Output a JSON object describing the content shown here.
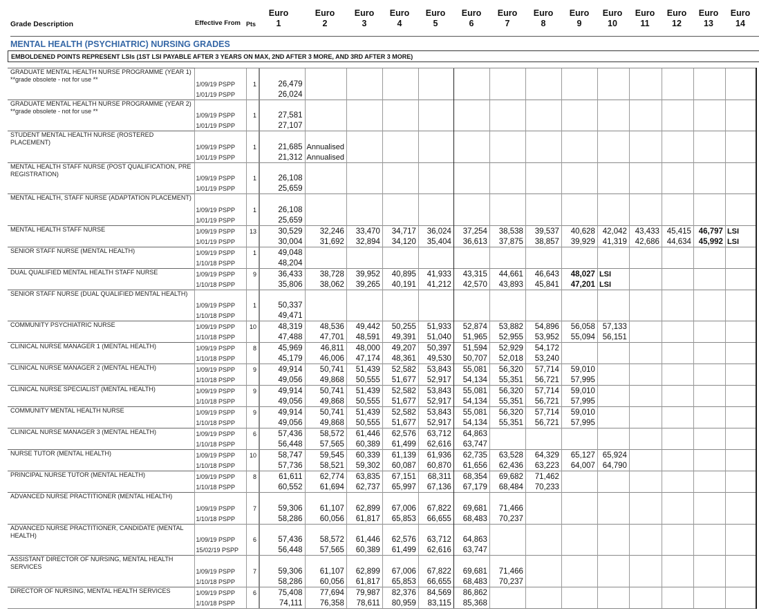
{
  "header": {
    "grade_description": "Grade Description",
    "effective_from": "Effective From",
    "pts": "Pts",
    "euro_label": "Euro",
    "euro_columns": [
      "1",
      "2",
      "3",
      "4",
      "5",
      "6",
      "7",
      "8",
      "9",
      "10",
      "11",
      "12",
      "13",
      "14"
    ]
  },
  "section_title": "MENTAL HEALTH (PSYCHIATRIC) NURSING GRADES",
  "note": "EMBOLDENED POINTS REPRESENT LSIs (1ST LSI PAYABLE AFTER 3 YEARS ON MAX, 2ND AFTER 3 MORE, AND 3RD AFTER 3 MORE)",
  "grades": [
    {
      "desc": "GRADUATE MENTAL HEALTH NURSE PROGRAMME (YEAR 1) **grade obsolete - not for use **",
      "tall": true,
      "pts": "1",
      "rows": [
        {
          "date": "1/09/19 PSPP",
          "values": [
            "26,479"
          ]
        },
        {
          "date": "1/01/19 PSPP",
          "values": [
            "26,024"
          ]
        }
      ]
    },
    {
      "desc": "GRADUATE MENTAL HEALTH NURSE PROGRAMME (YEAR 2) **grade obsolete - not for use **",
      "tall": true,
      "pts": "1",
      "rows": [
        {
          "date": "1/09/19 PSPP",
          "values": [
            "27,581"
          ]
        },
        {
          "date": "1/01/19 PSPP",
          "values": [
            "27,107"
          ]
        }
      ]
    },
    {
      "desc": "STUDENT MENTAL HEALTH NURSE (ROSTERED PLACEMENT)",
      "tall": true,
      "pts": "1",
      "rows": [
        {
          "date": "1/09/19 PSPP",
          "values": [
            "21,685",
            "Annualised"
          ]
        },
        {
          "date": "1/01/19 PSPP",
          "values": [
            "21,312",
            "Annualised"
          ]
        }
      ]
    },
    {
      "desc": "MENTAL HEALTH STAFF NURSE (POST QUALIFICATION, PRE REGISTRATION)",
      "tall": true,
      "pts": "1",
      "rows": [
        {
          "date": "1/09/19 PSPP",
          "values": [
            "26,108"
          ]
        },
        {
          "date": "1/01/19 PSPP",
          "values": [
            "25,659"
          ]
        }
      ]
    },
    {
      "desc": "MENTAL HEALTH, STAFF NURSE (ADAPTATION PLACEMENT)",
      "tall": true,
      "pts": "1",
      "rows": [
        {
          "date": "1/09/19 PSPP",
          "values": [
            "26,108"
          ]
        },
        {
          "date": "1/01/19 PSPP",
          "values": [
            "25,659"
          ]
        }
      ]
    },
    {
      "desc": "MENTAL HEALTH STAFF NURSE",
      "tall": false,
      "pts": "13",
      "lsi_index": 12,
      "rows": [
        {
          "date": "1/09/19 PSPP",
          "values": [
            "30,529",
            "32,246",
            "33,470",
            "34,717",
            "36,024",
            "37,254",
            "38,538",
            "39,537",
            "40,628",
            "42,042",
            "43,433",
            "45,415",
            "46,797",
            "LSI"
          ]
        },
        {
          "date": "1/01/19 PSPP",
          "values": [
            "30,004",
            "31,692",
            "32,894",
            "34,120",
            "35,404",
            "36,613",
            "37,875",
            "38,857",
            "39,929",
            "41,319",
            "42,686",
            "44,634",
            "45,992",
            "LSI"
          ]
        }
      ]
    },
    {
      "desc": "SENIOR STAFF NURSE (MENTAL HEALTH)",
      "tall": false,
      "pts": "1",
      "rows": [
        {
          "date": "1/09/19 PSPP",
          "values": [
            "49,048"
          ]
        },
        {
          "date": "1/10/18 PSPP",
          "values": [
            "48,204"
          ]
        }
      ]
    },
    {
      "desc": "DUAL QUALIFIED MENTAL HEALTH STAFF NURSE",
      "tall": false,
      "pts": "9",
      "lsi_index": 8,
      "rows": [
        {
          "date": "1/09/19 PSPP",
          "values": [
            "36,433",
            "38,728",
            "39,952",
            "40,895",
            "41,933",
            "43,315",
            "44,661",
            "46,643",
            "48,027",
            "LSI"
          ]
        },
        {
          "date": "1/10/18 PSPP",
          "values": [
            "35,806",
            "38,062",
            "39,265",
            "40,191",
            "41,212",
            "42,570",
            "43,893",
            "45,841",
            "47,201",
            "LSI"
          ]
        }
      ]
    },
    {
      "desc": "SENIOR STAFF NURSE (DUAL QUALIFIED MENTAL HEALTH)",
      "tall": true,
      "pts": "1",
      "rows": [
        {
          "date": "1/09/19 PSPP",
          "values": [
            "50,337"
          ]
        },
        {
          "date": "1/10/18 PSPP",
          "values": [
            "49,471"
          ]
        }
      ]
    },
    {
      "desc": "COMMUNITY PSYCHIATRIC NURSE",
      "tall": false,
      "pts": "10",
      "rows": [
        {
          "date": "1/09/19 PSPP",
          "values": [
            "48,319",
            "48,536",
            "49,442",
            "50,255",
            "51,933",
            "52,874",
            "53,882",
            "54,896",
            "56,058",
            "57,133"
          ]
        },
        {
          "date": "1/10/18 PSPP",
          "values": [
            "47,488",
            "47,701",
            "48,591",
            "49,391",
            "51,040",
            "51,965",
            "52,955",
            "53,952",
            "55,094",
            "56,151"
          ]
        }
      ]
    },
    {
      "desc": "CLINICAL NURSE MANAGER 1 (MENTAL HEALTH)",
      "tall": false,
      "pts": "8",
      "rows": [
        {
          "date": "1/09/19 PSPP",
          "values": [
            "45,969",
            "46,811",
            "48,000",
            "49,207",
            "50,397",
            "51,594",
            "52,929",
            "54,172"
          ]
        },
        {
          "date": "1/10/18 PSPP",
          "values": [
            "45,179",
            "46,006",
            "47,174",
            "48,361",
            "49,530",
            "50,707",
            "52,018",
            "53,240"
          ]
        }
      ]
    },
    {
      "desc": "CLINICAL NURSE MANAGER 2  (MENTAL HEALTH)",
      "tall": false,
      "pts": "9",
      "rows": [
        {
          "date": "1/09/19 PSPP",
          "values": [
            "49,914",
            "50,741",
            "51,439",
            "52,582",
            "53,843",
            "55,081",
            "56,320",
            "57,714",
            "59,010"
          ]
        },
        {
          "date": "1/10/18 PSPP",
          "values": [
            "49,056",
            "49,868",
            "50,555",
            "51,677",
            "52,917",
            "54,134",
            "55,351",
            "56,721",
            "57,995"
          ]
        }
      ]
    },
    {
      "desc": "CLINICAL NURSE SPECIALIST  (MENTAL HEALTH)",
      "tall": false,
      "pts": "9",
      "rows": [
        {
          "date": "1/09/19 PSPP",
          "values": [
            "49,914",
            "50,741",
            "51,439",
            "52,582",
            "53,843",
            "55,081",
            "56,320",
            "57,714",
            "59,010"
          ]
        },
        {
          "date": "1/10/18 PSPP",
          "values": [
            "49,056",
            "49,868",
            "50,555",
            "51,677",
            "52,917",
            "54,134",
            "55,351",
            "56,721",
            "57,995"
          ]
        }
      ]
    },
    {
      "desc": "COMMUNITY MENTAL HEALTH NURSE",
      "tall": false,
      "pts": "9",
      "rows": [
        {
          "date": "1/09/19 PSPP",
          "values": [
            "49,914",
            "50,741",
            "51,439",
            "52,582",
            "53,843",
            "55,081",
            "56,320",
            "57,714",
            "59,010"
          ]
        },
        {
          "date": "1/10/18 PSPP",
          "values": [
            "49,056",
            "49,868",
            "50,555",
            "51,677",
            "52,917",
            "54,134",
            "55,351",
            "56,721",
            "57,995"
          ]
        }
      ]
    },
    {
      "desc": "CLINICAL NURSE MANAGER 3 (MENTAL HEALTH)",
      "tall": false,
      "pts": "6",
      "rows": [
        {
          "date": "1/09/19 PSPP",
          "values": [
            "57,436",
            "58,572",
            "61,446",
            "62,576",
            "63,712",
            "64,863"
          ]
        },
        {
          "date": "1/10/18 PSPP",
          "values": [
            "56,448",
            "57,565",
            "60,389",
            "61,499",
            "62,616",
            "63,747"
          ]
        }
      ]
    },
    {
      "desc": "NURSE TUTOR  (MENTAL HEALTH)",
      "tall": false,
      "pts": "10",
      "rows": [
        {
          "date": "1/09/19 PSPP",
          "values": [
            "58,747",
            "59,545",
            "60,339",
            "61,139",
            "61,936",
            "62,735",
            "63,528",
            "64,329",
            "65,127",
            "65,924"
          ]
        },
        {
          "date": "1/10/18 PSPP",
          "values": [
            "57,736",
            "58,521",
            "59,302",
            "60,087",
            "60,870",
            "61,656",
            "62,436",
            "63,223",
            "64,007",
            "64,790"
          ]
        }
      ]
    },
    {
      "desc": "PRINCIPAL NURSE TUTOR (MENTAL HEALTH)",
      "tall": false,
      "pts": "8",
      "rows": [
        {
          "date": "1/09/19 PSPP",
          "values": [
            "61,611",
            "62,774",
            "63,835",
            "67,151",
            "68,311",
            "68,354",
            "69,682",
            "71,462"
          ]
        },
        {
          "date": "1/10/18 PSPP",
          "values": [
            "60,552",
            "61,694",
            "62,737",
            "65,997",
            "67,136",
            "67,179",
            "68,484",
            "70,233"
          ]
        }
      ]
    },
    {
      "desc": "ADVANCED NURSE PRACTITIONER (MENTAL HEALTH)",
      "tall": true,
      "pts": "7",
      "rows": [
        {
          "date": "1/09/19 PSPP",
          "values": [
            "59,306",
            "61,107",
            "62,899",
            "67,006",
            "67,822",
            "69,681",
            "71,466"
          ]
        },
        {
          "date": "1/10/18 PSPP",
          "values": [
            "58,286",
            "60,056",
            "61,817",
            "65,853",
            "66,655",
            "68,483",
            "70,237"
          ]
        }
      ]
    },
    {
      "desc": "ADVANCED NURSE PRACTITIONER, CANDIDATE (MENTAL HEALTH)",
      "tall": true,
      "pts": "6",
      "rows": [
        {
          "date": "1/09/19 PSPP",
          "values": [
            "57,436",
            "58,572",
            "61,446",
            "62,576",
            "63,712",
            "64,863"
          ]
        },
        {
          "date": "15/02/19 PSPP",
          "values": [
            "56,448",
            "57,565",
            "60,389",
            "61,499",
            "62,616",
            "63,747"
          ]
        }
      ]
    },
    {
      "desc": "ASSISTANT DIRECTOR OF NURSING, MENTAL HEALTH SERVICES",
      "tall": true,
      "pts": "7",
      "rows": [
        {
          "date": "1/09/19 PSPP",
          "values": [
            "59,306",
            "61,107",
            "62,899",
            "67,006",
            "67,822",
            "69,681",
            "71,466"
          ]
        },
        {
          "date": "1/10/18 PSPP",
          "values": [
            "58,286",
            "60,056",
            "61,817",
            "65,853",
            "66,655",
            "68,483",
            "70,237"
          ]
        }
      ]
    },
    {
      "desc": "DIRECTOR OF NURSING, MENTAL HEALTH SERVICES",
      "tall": false,
      "pts": "6",
      "rows": [
        {
          "date": "1/09/19 PSPP",
          "values": [
            "75,408",
            "77,694",
            "79,987",
            "82,376",
            "84,569",
            "86,862"
          ]
        },
        {
          "date": "1/10/18 PSPP",
          "values": [
            "74,111",
            "76,358",
            "78,611",
            "80,959",
            "83,115",
            "85,368"
          ]
        }
      ]
    }
  ]
}
